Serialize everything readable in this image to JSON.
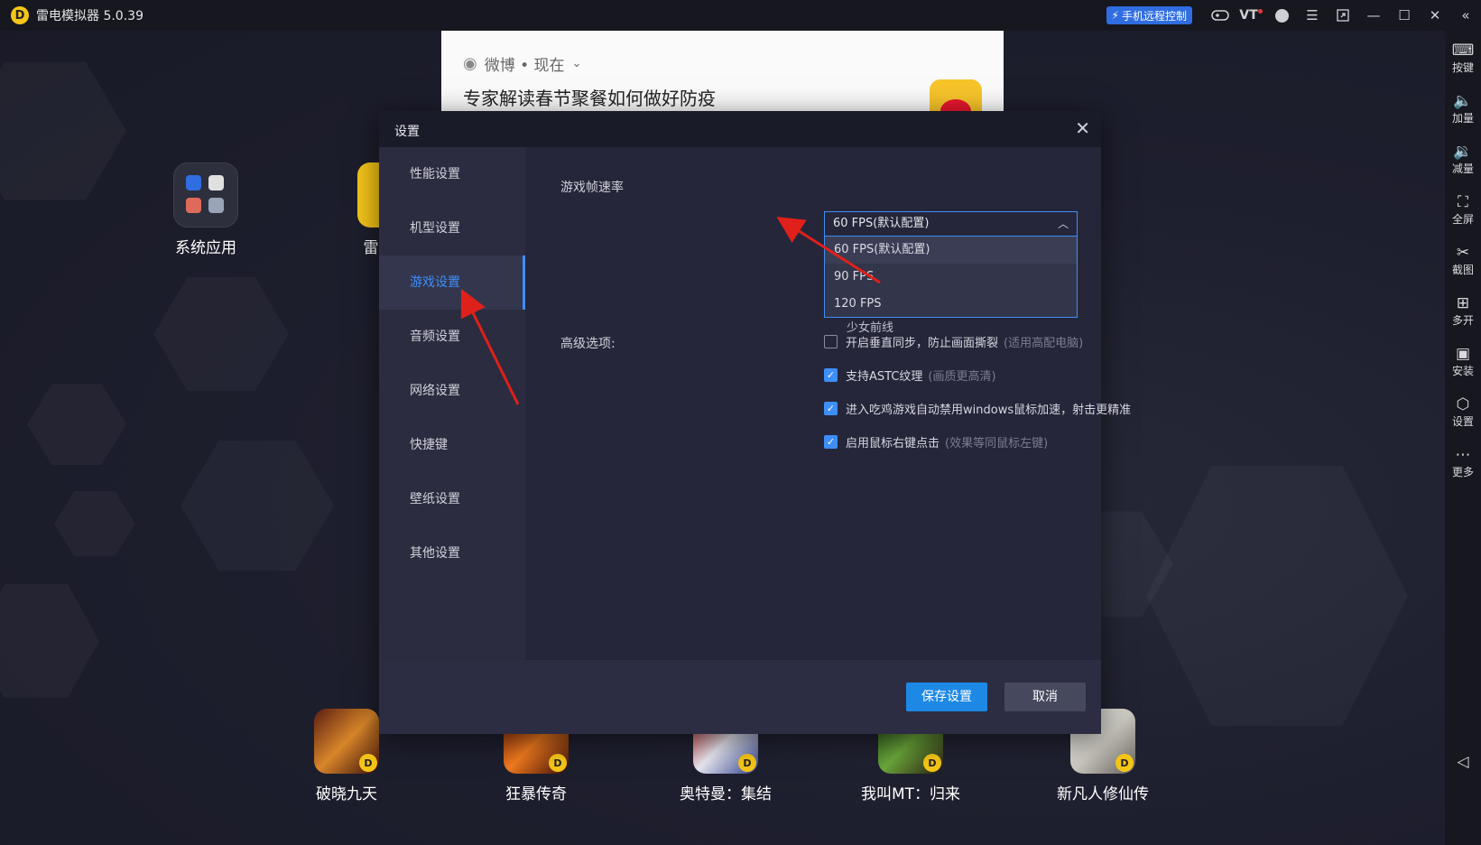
{
  "titlebar": {
    "app_title": "雷电模拟器 5.0.39",
    "logo_glyph": "D",
    "remote_control_label": "手机远程控制",
    "vt_label": "VT"
  },
  "right_toolbar": [
    {
      "label": "按键",
      "icon": "keyboard-icon"
    },
    {
      "label": "加量",
      "icon": "volume-up-icon"
    },
    {
      "label": "减量",
      "icon": "volume-down-icon"
    },
    {
      "label": "全屏",
      "icon": "fullscreen-icon"
    },
    {
      "label": "截图",
      "icon": "scissors-icon"
    },
    {
      "label": "多开",
      "icon": "multi-instance-icon"
    },
    {
      "label": "安装",
      "icon": "apk-install-icon"
    },
    {
      "label": "设置",
      "icon": "gear-icon"
    },
    {
      "label": "更多",
      "icon": "more-icon"
    }
  ],
  "notification": {
    "source": "微博 • 现在",
    "headline": "专家解读春节聚餐如何做好防疫"
  },
  "desktop": {
    "system_apps_label": "系统应用",
    "partial_label": "雷",
    "games": [
      {
        "label": "破晓九天"
      },
      {
        "label": "狂暴传奇"
      },
      {
        "label": "奥特曼：集结"
      },
      {
        "label": "我叫MT：归来"
      },
      {
        "label": "新凡人修仙传"
      }
    ]
  },
  "settings": {
    "title": "设置",
    "sidebar": [
      {
        "label": "性能设置"
      },
      {
        "label": "机型设置"
      },
      {
        "label": "游戏设置"
      },
      {
        "label": "音频设置"
      },
      {
        "label": "网络设置"
      },
      {
        "label": "快捷键"
      },
      {
        "label": "壁纸设置"
      },
      {
        "label": "其他设置"
      }
    ],
    "active_tab": "游戏设置",
    "frame_rate_label": "游戏帧速率",
    "frame_rate_value": "60 FPS(默认配置)",
    "frame_rate_options": [
      "60 FPS(默认配置)",
      "90 FPS",
      "120 FPS"
    ],
    "behind_dropdown_text": "少女前线",
    "advanced_label": "高级选项:",
    "advanced_options": [
      {
        "text": "开启垂直同步，防止画面撕裂",
        "hint": "(适用高配电脑)",
        "checked": false
      },
      {
        "text": "支持ASTC纹理",
        "hint": "(画质更高清)",
        "checked": true
      },
      {
        "text": "进入吃鸡游戏自动禁用windows鼠标加速，射击更精准",
        "hint": "",
        "checked": true
      },
      {
        "text": "启用鼠标右键点击",
        "hint": "(效果等同鼠标左键)",
        "checked": true
      }
    ],
    "save_label": "保存设置",
    "cancel_label": "取消"
  },
  "colors": {
    "accent": "#3e8ef7",
    "save_button": "#1e88e5",
    "annotation_arrow": "#e0201a"
  }
}
